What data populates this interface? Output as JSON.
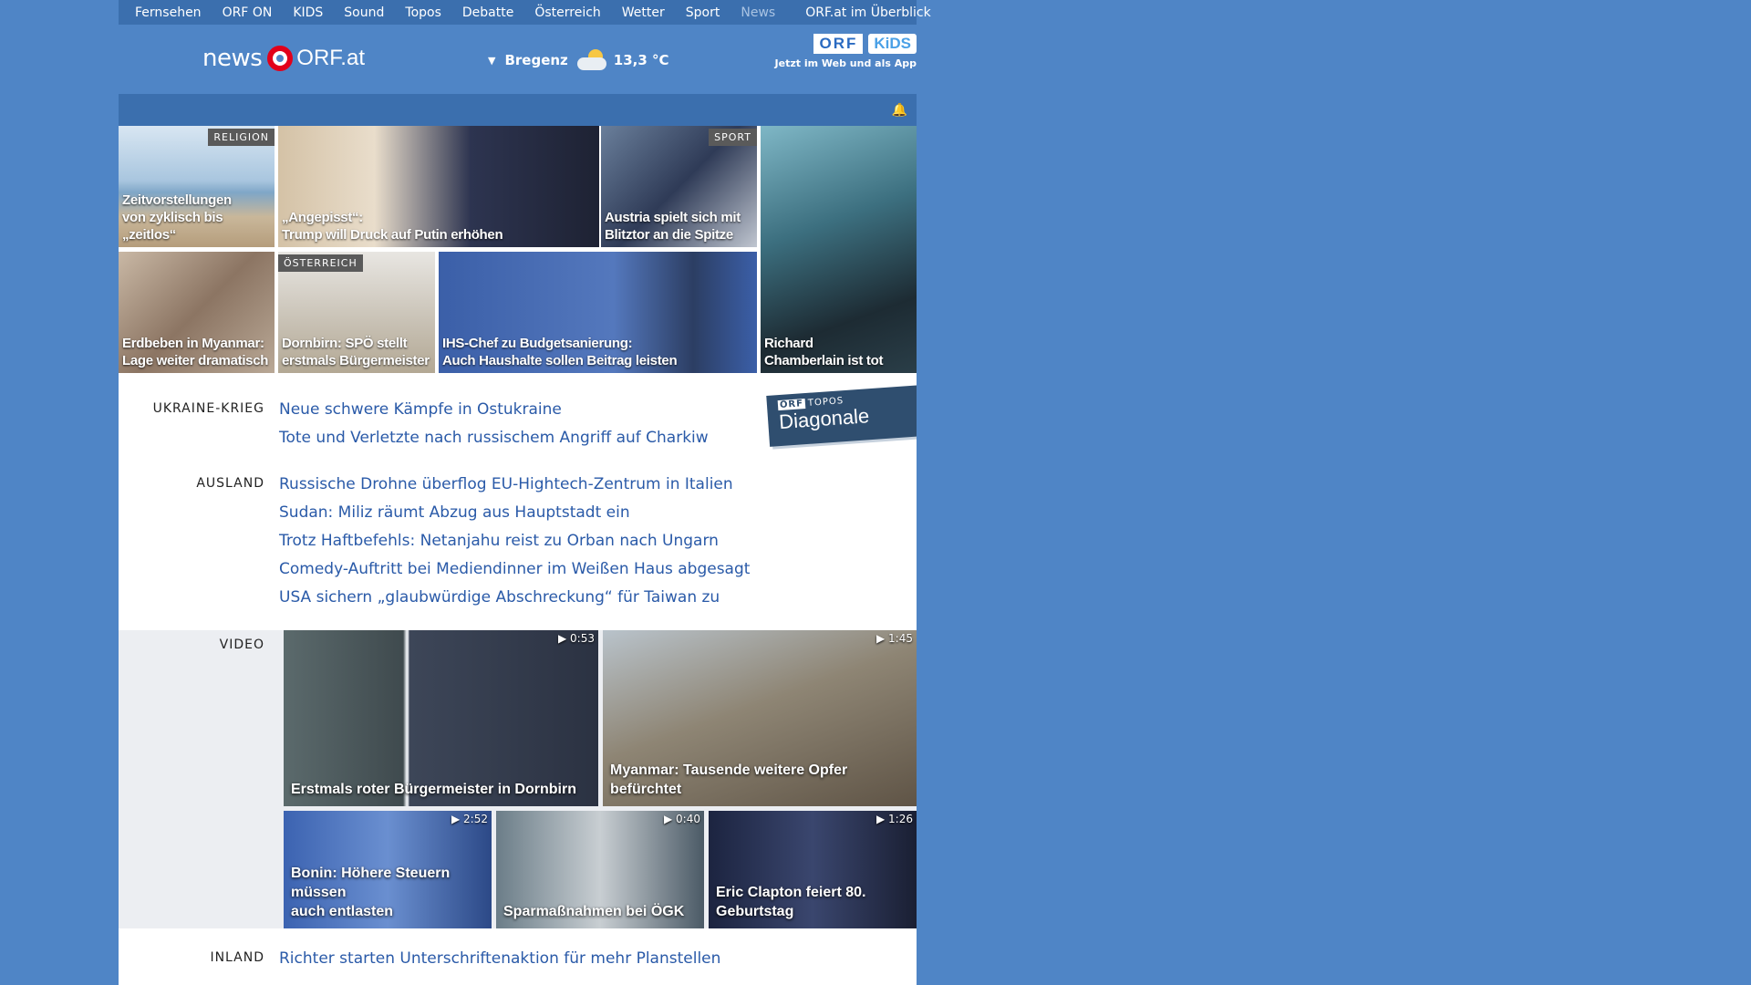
{
  "topnav": {
    "items": [
      "Fernsehen",
      "ORF ON",
      "KIDS",
      "Sound",
      "Topos",
      "Debatte",
      "Österreich",
      "Wetter",
      "Sport",
      "News"
    ],
    "overview": "ORF.at im Überblick"
  },
  "header": {
    "logo_news": "news",
    "logo_orf": "ORF.at",
    "weather": {
      "city": "Bregenz",
      "temp": "13,3 °C"
    },
    "kids": {
      "orf": "ORF",
      "kids": "KiDS",
      "sub": "Jetzt im Web und als App"
    }
  },
  "tiles": [
    {
      "tag": "RELIGION",
      "title": "Zeitvorstellungen\nvon zyklisch bis „zeitlos“"
    },
    {
      "tag": "",
      "title": "„Angepisst“:\nTrump will Druck auf Putin erhöhen"
    },
    {
      "tag": "SPORT",
      "title": "Austria spielt sich mit\nBlitztor an die Spitze"
    },
    {
      "tag": "",
      "title": "Richard\nChamberlain ist tot"
    },
    {
      "tag": "",
      "title": "Erdbeben in Myanmar:\nLage weiter dramatisch"
    },
    {
      "tag": "ÖSTERREICH",
      "title": "Dornbirn: SPÖ stellt\nerstmals Bürgermeister"
    },
    {
      "tag": "",
      "title": "IHS-Chef zu Budgetsanierung:\nAuch Haushalte sollen Beitrag leisten"
    }
  ],
  "diagonale": {
    "brand": "ORF",
    "small": "TOPOS",
    "big": "Diagonale"
  },
  "sections": {
    "ukraine": {
      "label": "UKRAINE-KRIEG",
      "links": [
        "Neue schwere Kämpfe in Ostukraine",
        "Tote und Verletzte nach russischem Angriff auf Charkiw"
      ]
    },
    "ausland": {
      "label": "AUSLAND",
      "links": [
        "Russische Drohne überflog EU-Hightech-Zentrum in Italien",
        "Sudan: Miliz räumt Abzug aus Hauptstadt ein",
        "Trotz Haftbefehls: Netanjahu reist zu Orban nach Ungarn",
        "Comedy-Auftritt bei Mediendinner im Weißen Haus abgesagt",
        "USA sichern „glaubwürdige Abschreckung“ für Taiwan zu"
      ]
    },
    "video": {
      "label": "VIDEO"
    },
    "inland": {
      "label": "INLAND",
      "links": [
        "Richter starten Unterschriftenaktion für mehr Planstellen"
      ]
    }
  },
  "videos": [
    {
      "duration": "0:53",
      "title": "Erstmals roter Bürgermeister in Dornbirn"
    },
    {
      "duration": "1:45",
      "title": "Myanmar: Tausende weitere Opfer\nbefürchtet"
    },
    {
      "duration": "2:52",
      "title": "Bonin: Höhere Steuern müssen\nauch entlasten"
    },
    {
      "duration": "0:40",
      "title": "Sparmaßnahmen bei ÖGK"
    },
    {
      "duration": "1:26",
      "title": "Eric Clapton feiert 80.\nGeburtstag"
    }
  ],
  "colors": {
    "page_bg": "#4f85c6",
    "nav_bg": "#3b6fae",
    "link": "#2a5aa8",
    "logo_red": "#e2001a"
  }
}
